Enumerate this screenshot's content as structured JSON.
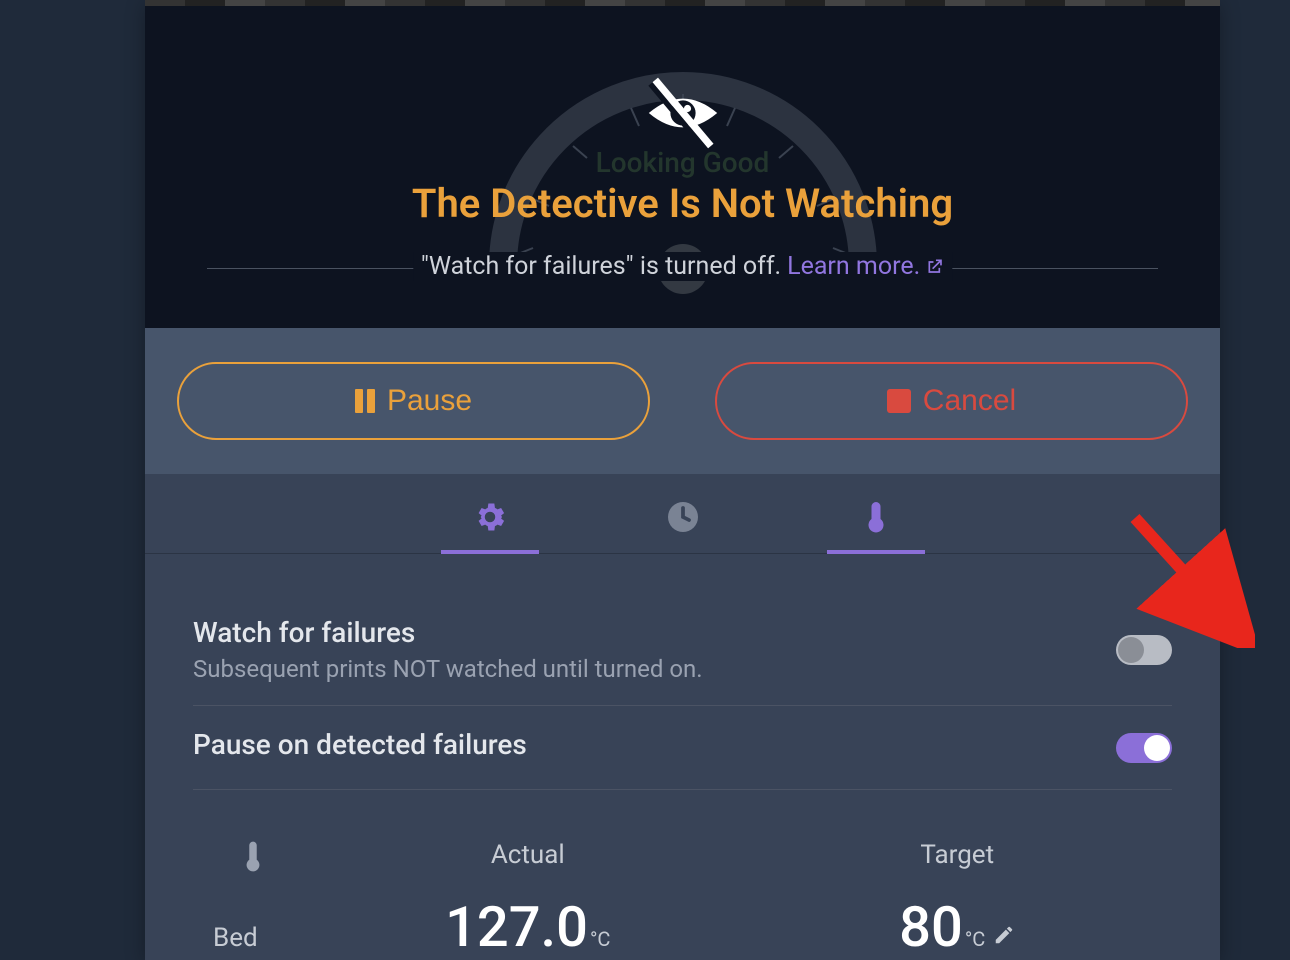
{
  "gauge": {
    "hidden_status": "Looking Good",
    "title": "The Detective Is Not Watching",
    "subtitle_text": "\"Watch for failures\" is turned off.",
    "learn_more": "Learn more."
  },
  "actions": {
    "pause": "Pause",
    "cancel": "Cancel"
  },
  "tabs": {
    "gear": "settings",
    "clock": "history",
    "thermo": "temperature"
  },
  "settings": {
    "watch": {
      "title": "Watch for failures",
      "subtitle": "Subsequent prints NOT watched until turned on.",
      "enabled": false
    },
    "pause_on_failure": {
      "title": "Pause on detected failures",
      "enabled": true
    }
  },
  "temps": {
    "actual_label": "Actual",
    "target_label": "Target",
    "rows": [
      {
        "name": "Bed",
        "actual": "127.0",
        "actual_unit": "°C",
        "target": "80",
        "target_unit": "°C"
      }
    ]
  }
}
